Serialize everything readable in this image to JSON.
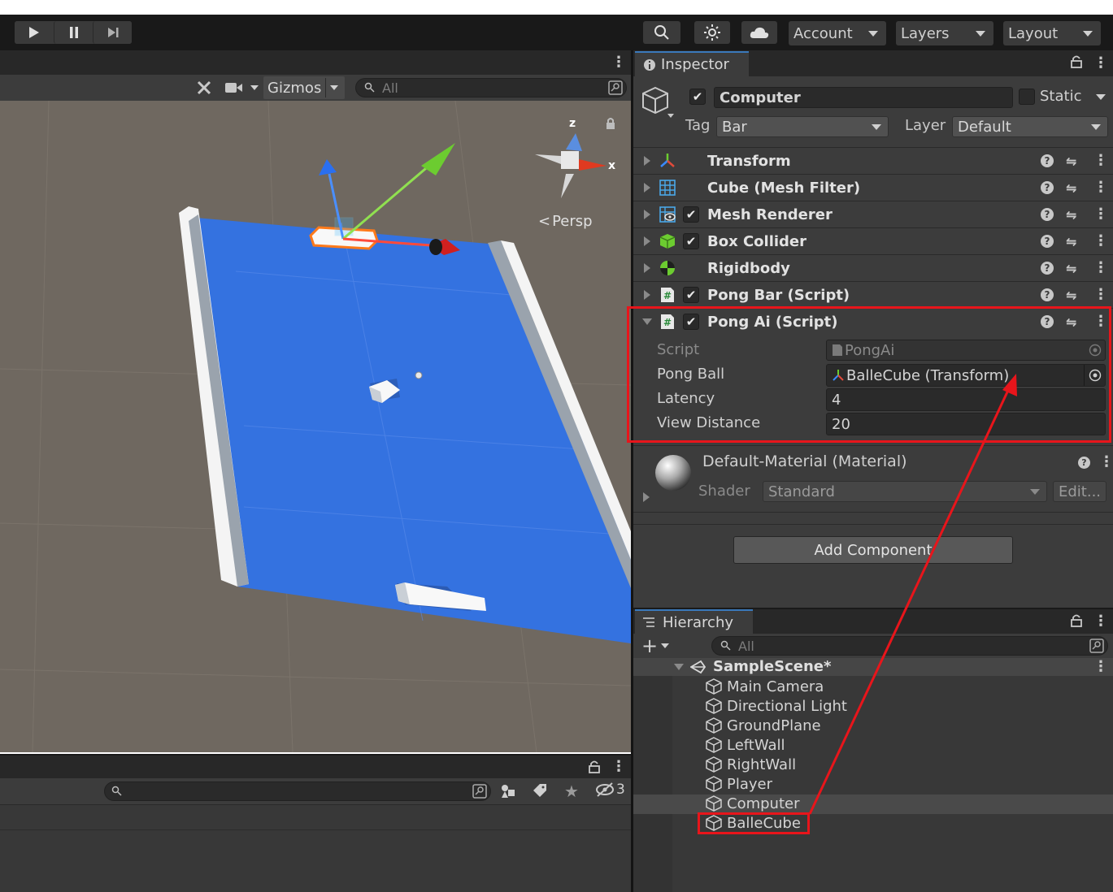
{
  "toolbar": {
    "account_label": "Account",
    "layers_label": "Layers",
    "layout_label": "Layout"
  },
  "scene": {
    "gizmos_label": "Gizmos",
    "search_placeholder": "All",
    "view_mode": "Persp",
    "axis_z": "z",
    "axis_x": "x"
  },
  "console": {
    "hidden_count": "3"
  },
  "inspector": {
    "tab_label": "Inspector",
    "object_name": "Computer",
    "static_label": "Static",
    "tag_label": "Tag",
    "tag_value": "Bar",
    "layer_label": "Layer",
    "layer_value": "Default",
    "components": [
      {
        "name": "Transform",
        "enabled_toggle": false
      },
      {
        "name": "Cube (Mesh Filter)",
        "enabled_toggle": false
      },
      {
        "name": "Mesh Renderer",
        "enabled_toggle": true
      },
      {
        "name": "Box Collider",
        "enabled_toggle": true
      },
      {
        "name": "Rigidbody",
        "enabled_toggle": false
      },
      {
        "name": "Pong Bar (Script)",
        "enabled_toggle": true
      },
      {
        "name": "Pong Ai (Script)",
        "enabled_toggle": true
      }
    ],
    "pong_ai": {
      "script_label": "Script",
      "script_value": "PongAi",
      "pong_ball_label": "Pong Ball",
      "pong_ball_value": "BalleCube (Transform)",
      "latency_label": "Latency",
      "latency_value": "4",
      "view_distance_label": "View Distance",
      "view_distance_value": "20"
    },
    "material": {
      "name": "Default-Material (Material)",
      "shader_label": "Shader",
      "shader_value": "Standard",
      "edit_label": "Edit..."
    },
    "add_component_label": "Add Component"
  },
  "hierarchy": {
    "tab_label": "Hierarchy",
    "search_placeholder": "All",
    "scene_name": "SampleScene*",
    "items": [
      "Main Camera",
      "Directional Light",
      "GroundPlane",
      "LeftWall",
      "RightWall",
      "Player",
      "Computer",
      "BalleCube"
    ],
    "selected_item": "Computer"
  },
  "colors": {
    "highlight_red": "#e8151b",
    "tab_accent": "#3a79bb",
    "ground_blue": "#3472e0"
  }
}
